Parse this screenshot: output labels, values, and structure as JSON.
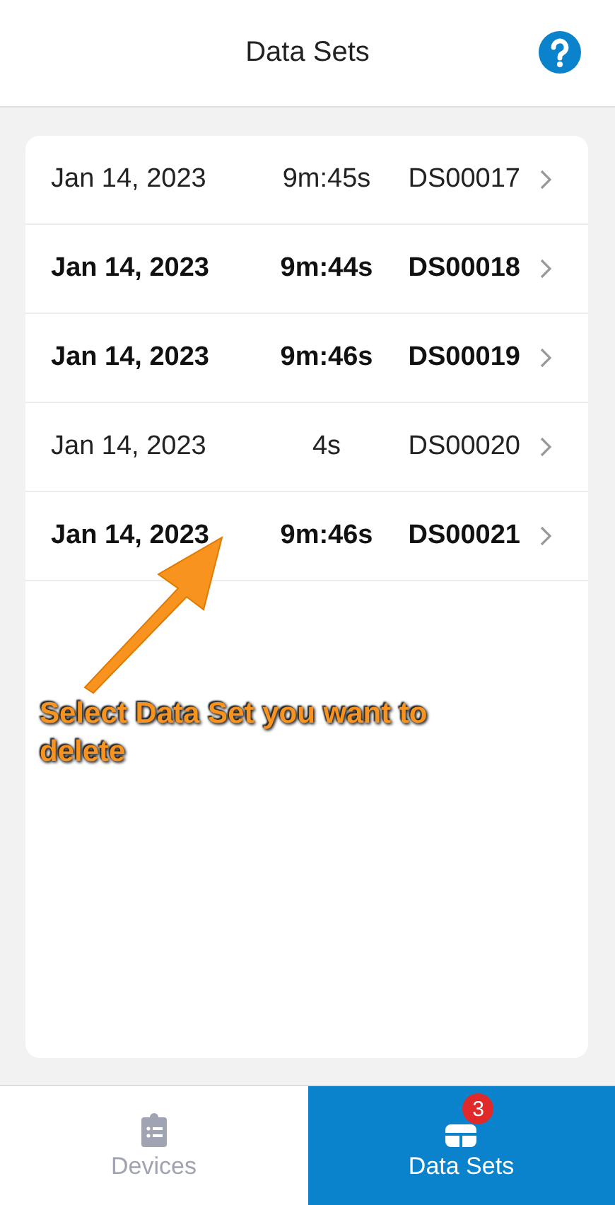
{
  "header": {
    "title": "Data Sets"
  },
  "rows": [
    {
      "date": "Jan 14, 2023",
      "duration": "9m:45s",
      "id": "DS00017",
      "unread": false
    },
    {
      "date": "Jan 14, 2023",
      "duration": "9m:44s",
      "id": "DS00018",
      "unread": true
    },
    {
      "date": "Jan 14, 2023",
      "duration": "9m:46s",
      "id": "DS00019",
      "unread": true
    },
    {
      "date": "Jan 14, 2023",
      "duration": "4s",
      "id": "DS00020",
      "unread": false
    },
    {
      "date": "Jan 14, 2023",
      "duration": "9m:46s",
      "id": "DS00021",
      "unread": true
    }
  ],
  "annotation": {
    "text": "Select Data Set you want to delete"
  },
  "tabs": [
    {
      "label": "Devices",
      "kind": "devices",
      "selected": false
    },
    {
      "label": "Data Sets",
      "kind": "datasets",
      "selected": true,
      "badge": "3"
    }
  ]
}
